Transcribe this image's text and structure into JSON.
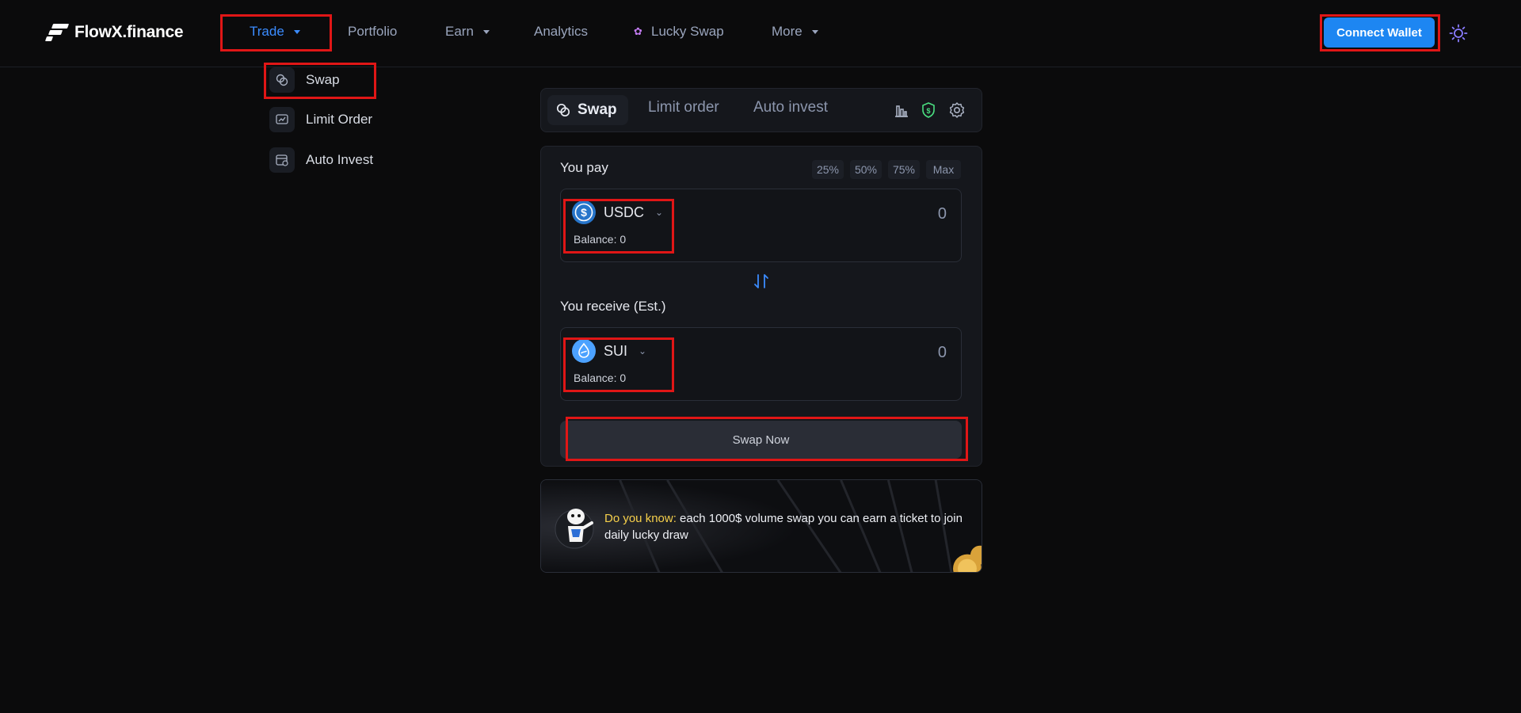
{
  "header": {
    "logo_text": "FlowX.finance",
    "nav": [
      {
        "label": "Trade",
        "has_caret": true,
        "active": true
      },
      {
        "label": "Portfolio",
        "has_caret": false
      },
      {
        "label": "Earn",
        "has_caret": true
      },
      {
        "label": "Analytics",
        "has_caret": false
      },
      {
        "label": "Lucky Swap",
        "has_caret": false,
        "icon": "sparkle-icon"
      },
      {
        "label": "More",
        "has_caret": true
      }
    ],
    "connect_wallet_label": "Connect Wallet",
    "theme_icon": "sun-icon"
  },
  "trade_menu": {
    "items": [
      {
        "label": "Swap",
        "icon": "swap-icon"
      },
      {
        "label": "Limit Order",
        "icon": "limit-order-icon"
      },
      {
        "label": "Auto Invest",
        "icon": "auto-invest-icon"
      }
    ]
  },
  "tabs": {
    "items": [
      "Swap",
      "Limit order",
      "Auto invest"
    ],
    "tools": [
      "chart-icon",
      "shield-icon",
      "gear-icon"
    ]
  },
  "swap": {
    "pay_label": "You pay",
    "percent_buttons": [
      "25%",
      "50%",
      "75%",
      "Max"
    ],
    "pay_token": {
      "symbol": "USDC",
      "balance": "Balance: 0",
      "amount": "0"
    },
    "receive_label": "You receive (Est.)",
    "receive_token": {
      "symbol": "SUI",
      "balance": "Balance: 0",
      "amount": "0"
    },
    "swap_now_label": "Swap Now"
  },
  "banner": {
    "highlight": "Do you know:",
    "text": " each 1000$ volume swap you can earn a ticket to join daily lucky draw"
  },
  "colors": {
    "background": "#0b0b0c",
    "accent": "#1d86f2",
    "active_nav": "#3b8cff",
    "highlight_box": "#e01616",
    "banner_highlight": "#f6d04b"
  }
}
